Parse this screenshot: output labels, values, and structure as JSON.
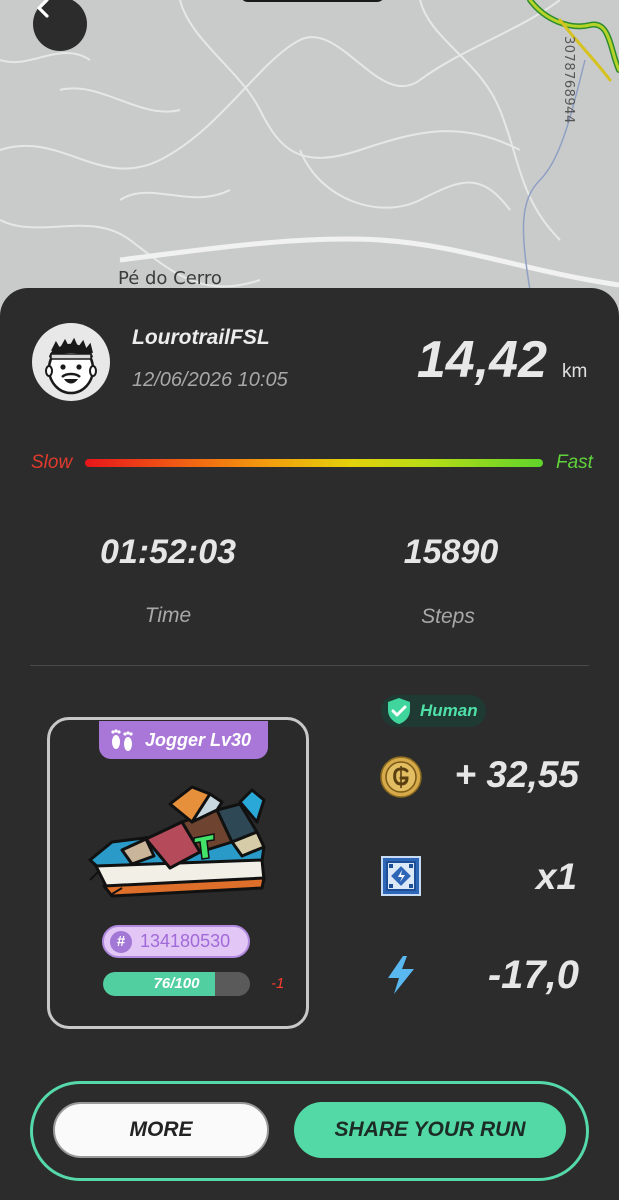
{
  "map": {
    "place_label": "Pé do Cerro",
    "id_label": "3078768944"
  },
  "header": {
    "back_icon": "chevron-left-icon",
    "username": "LourotrailFSL",
    "datetime": "12/06/2026 10:05",
    "distance": "14,42",
    "distance_unit": "km"
  },
  "speed": {
    "slow_label": "Slow",
    "fast_label": "Fast"
  },
  "stats": {
    "time_value": "01:52:03",
    "time_label": "Time",
    "steps_value": "15890",
    "steps_label": "Steps"
  },
  "sneaker": {
    "type_label": "Jogger Lv30",
    "token_id": "134180530",
    "durability_text": "76/100",
    "durability_fraction": 0.76,
    "durability_delta": "-1"
  },
  "rewards": {
    "human_label": "Human",
    "gst_value": "+ 32,55",
    "mystery_box_value": "x1",
    "energy_value": "-17,0"
  },
  "actions": {
    "more_label": "MORE",
    "share_label": "SHARE YOUR RUN"
  },
  "colors": {
    "accent_green": "#52d9a6",
    "sheet_bg": "#2c2c2c",
    "badge_purple": "#a977d8"
  }
}
